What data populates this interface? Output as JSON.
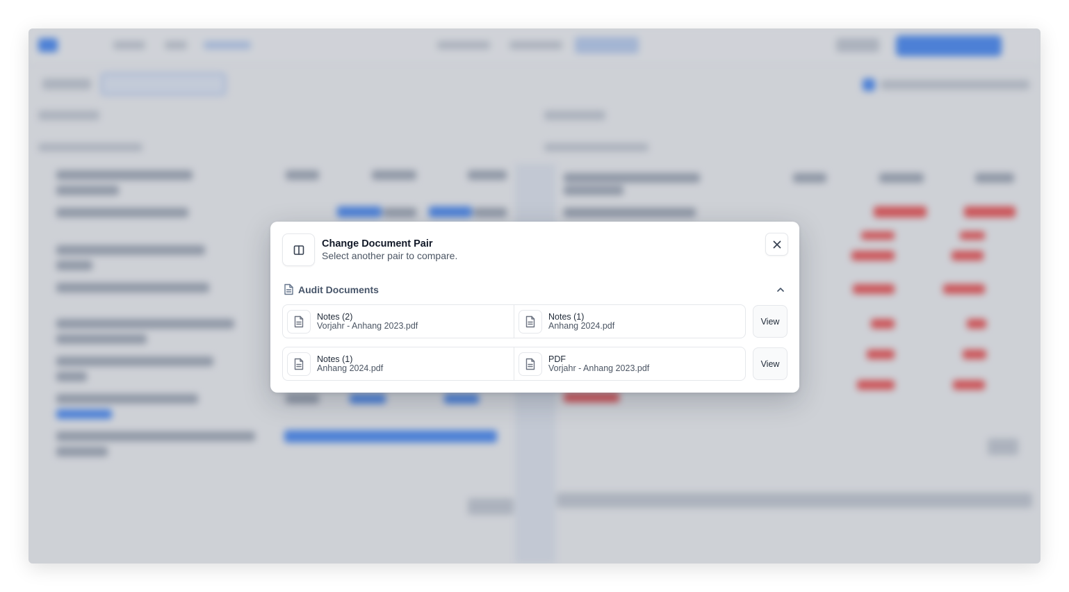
{
  "dialog": {
    "title": "Change Document Pair",
    "subtitle": "Select another pair to compare.",
    "section_title": "Audit Documents",
    "pairs": [
      {
        "left": {
          "name": "Notes (2)",
          "file": "Vorjahr - Anhang 2023.pdf"
        },
        "right": {
          "name": "Notes (1)",
          "file": "Anhang 2024.pdf"
        },
        "action": "View"
      },
      {
        "left": {
          "name": "Notes (1)",
          "file": "Anhang 2024.pdf"
        },
        "right": {
          "name": "PDF",
          "file": "Vorjahr - Anhang 2023.pdf"
        },
        "action": "View"
      }
    ]
  },
  "icons": {
    "header": "compare-columns-icon",
    "close": "close-icon",
    "section": "document-icon",
    "collapse": "chevron-up-icon",
    "file": "file-text-icon"
  },
  "colors": {
    "overlay": "#787e8a",
    "accent_blue": "#3b82f6",
    "diff_red": "#ef4444"
  }
}
